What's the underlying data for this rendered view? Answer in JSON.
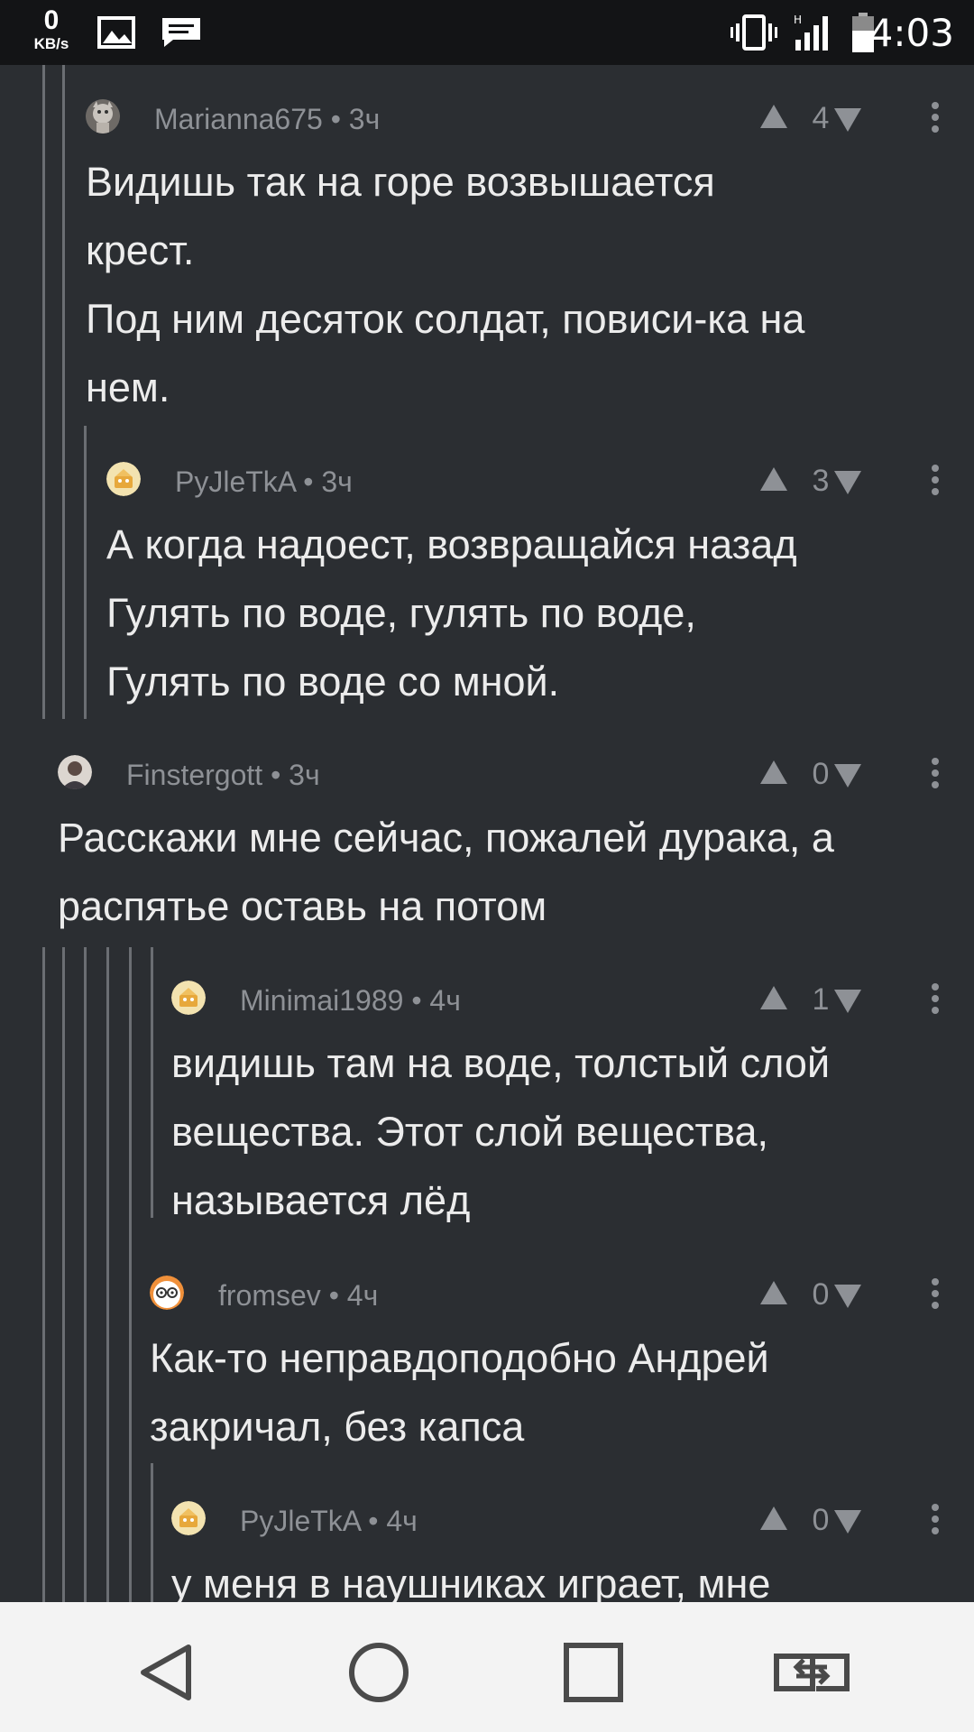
{
  "status_bar": {
    "speed_value": "0",
    "speed_unit": "KB/s",
    "time": "4:03",
    "icons": [
      "image-icon",
      "message-icon",
      "vibrate-icon",
      "signal-icon",
      "battery-icon"
    ]
  },
  "comments": [
    {
      "author": "Marianna675",
      "age": "3ч",
      "meta": "Marianna675 • 3ч",
      "votes": "4",
      "lines": [
        "Видишь так на горе возвышается",
        "крест.",
        "Под ним десяток солдат, повиси-ка на",
        "нем."
      ]
    },
    {
      "author": "PyJleTkA",
      "age": "3ч",
      "meta": "PyJleTkA • 3ч",
      "votes": "3",
      "lines": [
        "А когда надоест, возвращайся назад",
        "Гулять по воде, гулять по воде,",
        "Гулять по воде со мной."
      ]
    },
    {
      "author": "Finstergott",
      "age": "3ч",
      "meta": "Finstergott • 3ч",
      "votes": "0",
      "lines": [
        "Расскажи мне сейчас, пожалей дурака, а",
        "распятье оставь на потом"
      ]
    },
    {
      "author": "Minimai1989",
      "age": "4ч",
      "meta": "Minimai1989 • 4ч",
      "votes": "1",
      "lines": [
        "видишь там на воде, толстый слой",
        "вещества. Этот слой вещества,",
        "называется лёд"
      ]
    },
    {
      "author": "fromsev",
      "age": "4ч",
      "meta": "fromsev • 4ч",
      "votes": "0",
      "lines": [
        "Как-то неправдоподобно Андрей",
        "закричал, без капса"
      ]
    },
    {
      "author": "PyJleTkA",
      "age": "4ч",
      "meta": "PyJleTkA • 4ч",
      "votes": "0",
      "lines": [
        "у меня в наушниках играет, мне"
      ]
    }
  ],
  "nav_bar": {
    "buttons": [
      "back-button",
      "home-button",
      "recents-button",
      "switch-apps-button"
    ]
  },
  "colors": {
    "background": "#2b2e32",
    "status_bar": "#131416",
    "nav_bar": "#f3f3f3",
    "meta_text": "#8e9196",
    "body_text": "#ececec",
    "thread_line": "#6b6e73"
  }
}
